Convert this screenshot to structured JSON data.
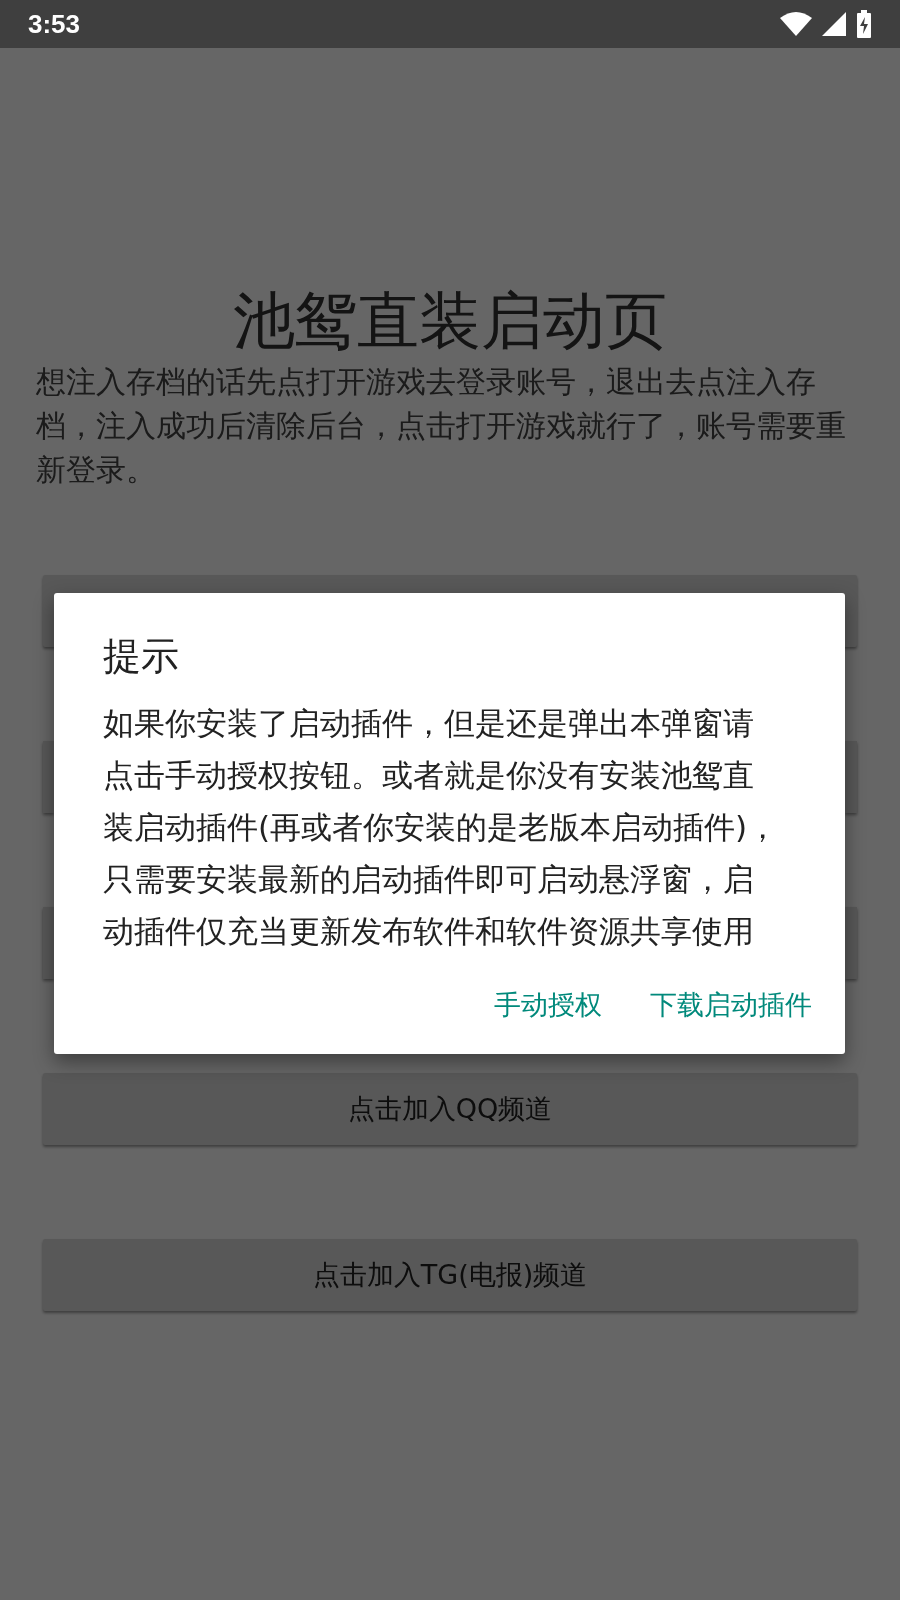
{
  "status_bar": {
    "time": "3:53"
  },
  "page": {
    "title": "池鸳直装启动页",
    "description": "想注入存档的话先点打开游戏去登录账号，退出去点注入存档，注入成功后清除后台，点击打开游戏就行了，账号需要重新登录。",
    "buttons": [
      {
        "kind": "covered"
      },
      {
        "kind": "edges"
      },
      {
        "kind": "edges"
      },
      {
        "kind": "labeled",
        "label": "点击加入QQ频道"
      },
      {
        "kind": "labeled",
        "label": "点击加入TG(电报)频道"
      }
    ]
  },
  "dialog": {
    "title": "提示",
    "message": "如果你安装了启动插件，但是还是弹出本弹窗请点击手动授权按钮。或者就是你没有安装池鸳直装启动插件(再或者你安装的是老版本启动插件)，只需要安装最新的启动插件即可启动悬浮窗，启动插件仅充当更新发布软件和软件资源共享使用",
    "actions": [
      "手动授权",
      "下载启动插件"
    ]
  }
}
